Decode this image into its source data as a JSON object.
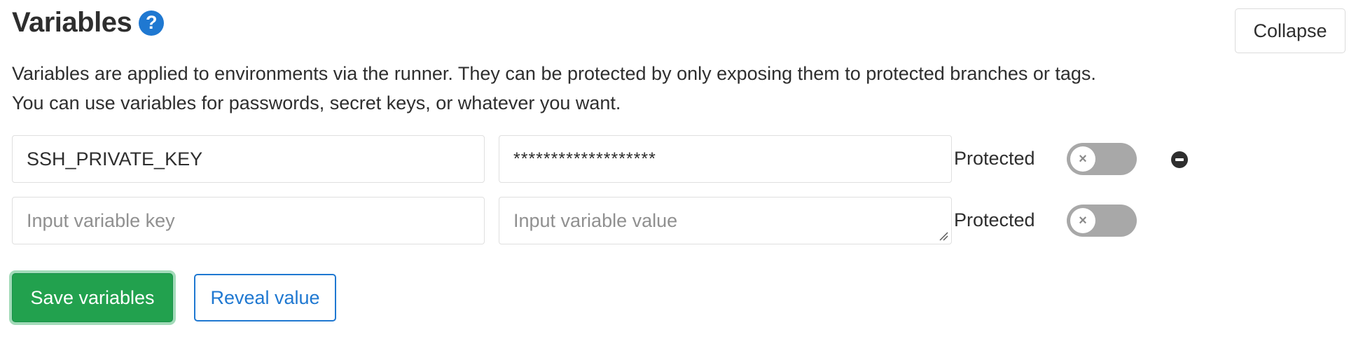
{
  "header": {
    "title": "Variables",
    "help_icon": "question-circle-icon",
    "collapse_label": "Collapse"
  },
  "description": {
    "line1": "Variables are applied to environments via the runner. They can be protected by only exposing them to protected branches or tags.",
    "line2": "You can use variables for passwords, secret keys, or whatever you want."
  },
  "variables": [
    {
      "key": "SSH_PRIVATE_KEY",
      "value": "*******************",
      "protected_label": "Protected",
      "protected": false,
      "remove_icon": "minus-circle-icon"
    },
    {
      "key_placeholder": "Input variable key",
      "value_placeholder": "Input variable value",
      "protected_label": "Protected",
      "protected": false
    }
  ],
  "actions": {
    "save_label": "Save variables",
    "reveal_label": "Reveal value"
  },
  "colors": {
    "accent_blue": "#1f78d1",
    "save_green": "#22a14e",
    "toggle_off": "#a8a8a8"
  }
}
